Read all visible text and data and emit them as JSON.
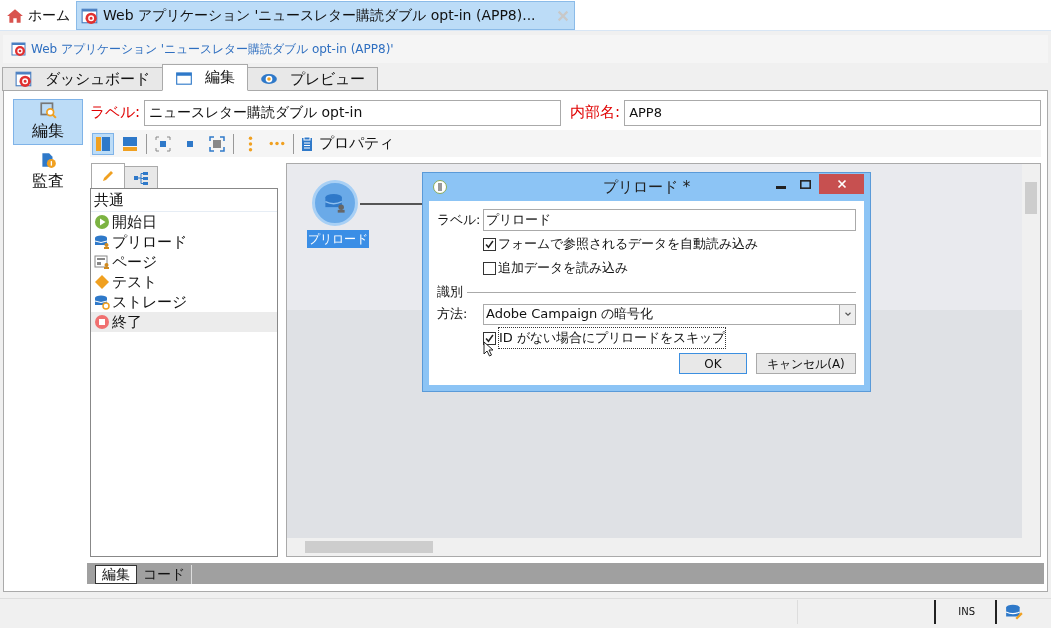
{
  "tabs": [
    {
      "label": "ホーム",
      "kind": "home",
      "selected": false
    },
    {
      "label": "Web アプリケーション 'ニュースレター購読ダブル opt-in (APP8)...",
      "kind": "document",
      "selected": true
    }
  ],
  "breadcrumb": "Web アプリケーション 'ニュースレター購読ダブル opt-in (APP8)'",
  "view_tabs": [
    {
      "label": "ダッシュボード",
      "kind": "app",
      "selected": false
    },
    {
      "label": "編集",
      "kind": "window",
      "selected": true
    },
    {
      "label": "プレビュー",
      "kind": "eye",
      "selected": false
    }
  ],
  "sidebar": {
    "items": [
      {
        "label": "編集",
        "kind": "edit",
        "selected": true
      },
      {
        "label": "監査",
        "kind": "audit",
        "selected": false
      }
    ]
  },
  "form": {
    "label_caption": "ラベル:",
    "label_value": "ニュースレター購読ダブル opt-in",
    "internal_name_caption": "内部名:",
    "internal_name_value": "APP8"
  },
  "toolbar": {
    "items": [
      {
        "kind": "layout-vertical",
        "selected": true
      },
      {
        "kind": "layout-horizontal",
        "selected": false
      },
      {
        "kind": "fit",
        "selected": false
      },
      {
        "kind": "normal-size",
        "selected": false
      },
      {
        "kind": "zoom-fit",
        "selected": false
      },
      {
        "kind": "align-vertical",
        "selected": false
      },
      {
        "kind": "align-horizontal",
        "selected": false
      }
    ],
    "properties_label": "プロパティ"
  },
  "palette": {
    "tabs": [
      {
        "kind": "pencil",
        "selected": true
      },
      {
        "kind": "tree",
        "selected": false
      }
    ],
    "header": "共通",
    "items": [
      {
        "label": "開始日",
        "kind": "start",
        "selected": false
      },
      {
        "label": "プリロード",
        "kind": "preload",
        "selected": false
      },
      {
        "label": "ページ",
        "kind": "page",
        "selected": false
      },
      {
        "label": "テスト",
        "kind": "test",
        "selected": false
      },
      {
        "label": "ストレージ",
        "kind": "storage",
        "selected": false
      },
      {
        "label": "終了",
        "kind": "end",
        "selected": true
      }
    ]
  },
  "canvas": {
    "nodes": [
      {
        "label": "プリロード",
        "selected": true
      }
    ]
  },
  "dialog": {
    "title": "プリロード *",
    "label_caption": "ラベル:",
    "label_value": "プリロード",
    "options": [
      {
        "label": "フォームで参照されるデータを自動読み込み",
        "checked": true
      },
      {
        "label": "追加データを読み込み",
        "checked": false
      }
    ],
    "section": "識別",
    "method_caption": "方法:",
    "method_value": "Adobe Campaign の暗号化",
    "skip_option": {
      "label": "ID がない場合にプリロードをスキップ",
      "checked": true
    },
    "buttons": [
      {
        "label": "OK",
        "default": true
      },
      {
        "label": "キャンセル(A)",
        "default": false
      }
    ]
  },
  "bottom_tabs": [
    {
      "label": "編集",
      "selected": true
    },
    {
      "label": "コード",
      "selected": false
    }
  ],
  "status_bar": {
    "mode": "INS"
  }
}
